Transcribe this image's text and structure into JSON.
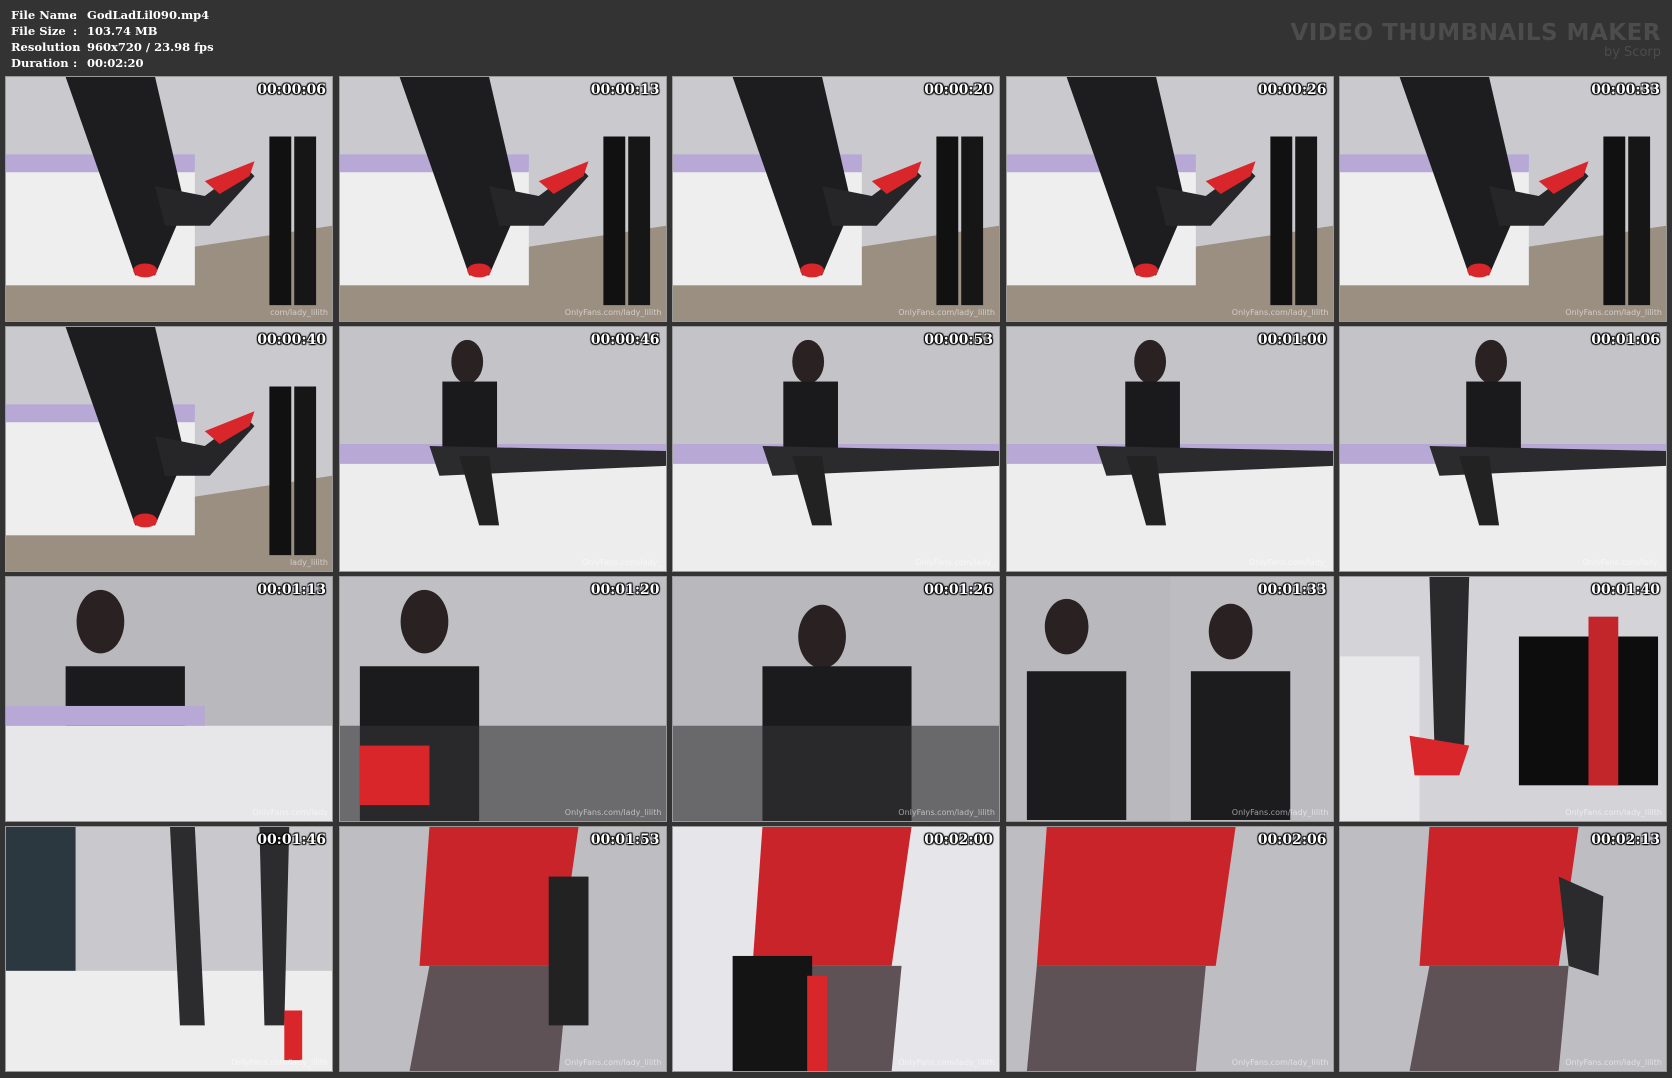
{
  "info": {
    "file_name_label": "File Name",
    "file_name": "GodLadLil090.mp4",
    "file_size_label": "File Size",
    "file_size": "103.74 MB",
    "resolution_label": "Resolution",
    "resolution": "960x720 / 23.98 fps",
    "duration_label": "Duration",
    "duration": "00:02:20",
    "separator": ":"
  },
  "brand": {
    "title": "VIDEO THUMBNAILS MAKER",
    "subtitle": "by Scorp"
  },
  "colors": {
    "background": "#333333",
    "brand_text": "#4c4c4c",
    "accent_red": "#d8262a"
  },
  "thumbnails": [
    {
      "time": "00:00:06",
      "watermark": "com/lady_lilith"
    },
    {
      "time": "00:00:13",
      "watermark": "OnlyFans.com/lady_lilith"
    },
    {
      "time": "00:00:20",
      "watermark": "OnlyFans.com/lady_lilith"
    },
    {
      "time": "00:00:26",
      "watermark": "OnlyFans.com/lady_lilith"
    },
    {
      "time": "00:00:33",
      "watermark": "OnlyFans.com/lady_lilith"
    },
    {
      "time": "00:00:40",
      "watermark": "lady_lilith"
    },
    {
      "time": "00:00:46",
      "watermark": "OnlyFans.com/lady_"
    },
    {
      "time": "00:00:53",
      "watermark": "OnlyFans.com/lady_"
    },
    {
      "time": "00:01:00",
      "watermark": "OnlyFans.com/lady_"
    },
    {
      "time": "00:01:06",
      "watermark": "OnlyFans.com/lady_"
    },
    {
      "time": "00:01:13",
      "watermark": "OnlyFans.com/lady"
    },
    {
      "time": "00:01:20",
      "watermark": "OnlyFans.com/lady_lilith"
    },
    {
      "time": "00:01:26",
      "watermark": "OnlyFans.com/lady_lilith"
    },
    {
      "time": "00:01:33",
      "watermark": "OnlyFans.com/lady_lilith"
    },
    {
      "time": "00:01:40",
      "watermark": "OnlyFans.com/lady_lilith"
    },
    {
      "time": "00:01:46",
      "watermark": "OnlyFans.com/lady_lilith"
    },
    {
      "time": "00:01:53",
      "watermark": "OnlyFans.com/lady_lilith"
    },
    {
      "time": "00:02:00",
      "watermark": "OnlyFans.com/lady_lilith"
    },
    {
      "time": "00:02:06",
      "watermark": "OnlyFans.com/lady_lilith"
    },
    {
      "time": "00:02:13",
      "watermark": "OnlyFans.com/lady_lilith"
    }
  ]
}
